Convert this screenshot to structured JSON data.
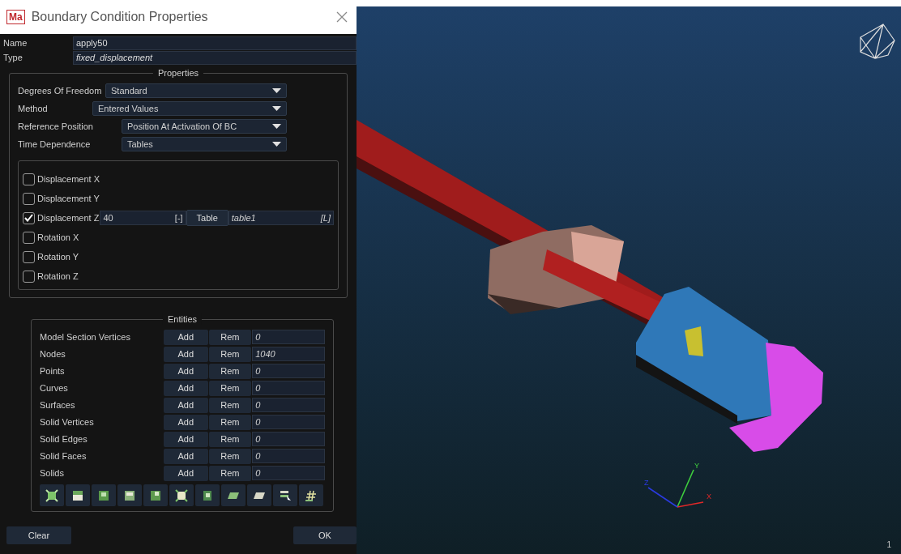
{
  "dialog": {
    "logo": "Ma",
    "title": "Boundary Condition Properties"
  },
  "fields": [
    {
      "label": "Name",
      "value": "apply50",
      "italic": false
    },
    {
      "label": "Type",
      "value": "fixed_displacement",
      "italic": true
    }
  ],
  "properties": {
    "title": "Properties",
    "dropdowns": [
      {
        "label": "Degrees Of Freedom",
        "value": "Standard"
      },
      {
        "label": "Method",
        "value": "Entered Values"
      },
      {
        "label": "Reference Position",
        "value": "Position At Activation Of BC"
      },
      {
        "label": "Time Dependence",
        "value": "Tables"
      }
    ],
    "dofs": [
      {
        "label": "Displacement X",
        "checked": false
      },
      {
        "label": "Displacement Y",
        "checked": false
      },
      {
        "label": "Displacement Z",
        "checked": true,
        "value": "40",
        "unit": "[-]",
        "table_button": "Table",
        "table_name": "table1",
        "table_unit": "[L]"
      },
      {
        "label": "Rotation X",
        "checked": false
      },
      {
        "label": "Rotation Y",
        "checked": false
      },
      {
        "label": "Rotation Z",
        "checked": false
      }
    ]
  },
  "entities": {
    "title": "Entities",
    "rows": [
      {
        "label": "Model Section Vertices",
        "add": "Add",
        "rem": "Rem",
        "count": "0"
      },
      {
        "label": "Nodes",
        "add": "Add",
        "rem": "Rem",
        "count": "1040"
      },
      {
        "label": "Points",
        "add": "Add",
        "rem": "Rem",
        "count": "0"
      },
      {
        "label": "Curves",
        "add": "Add",
        "rem": "Rem",
        "count": "0"
      },
      {
        "label": "Surfaces",
        "add": "Add",
        "rem": "Rem",
        "count": "0"
      },
      {
        "label": "Solid Vertices",
        "add": "Add",
        "rem": "Rem",
        "count": "0"
      },
      {
        "label": "Solid Edges",
        "add": "Add",
        "rem": "Rem",
        "count": "0"
      },
      {
        "label": "Solid Faces",
        "add": "Add",
        "rem": "Rem",
        "count": "0"
      },
      {
        "label": "Solids",
        "add": "Add",
        "rem": "Rem",
        "count": "0"
      }
    ]
  },
  "buttons": {
    "clear": "Clear",
    "ok": "OK"
  },
  "viewport": {
    "axes": [
      "X",
      "Y",
      "Z"
    ],
    "view_number": "1"
  }
}
